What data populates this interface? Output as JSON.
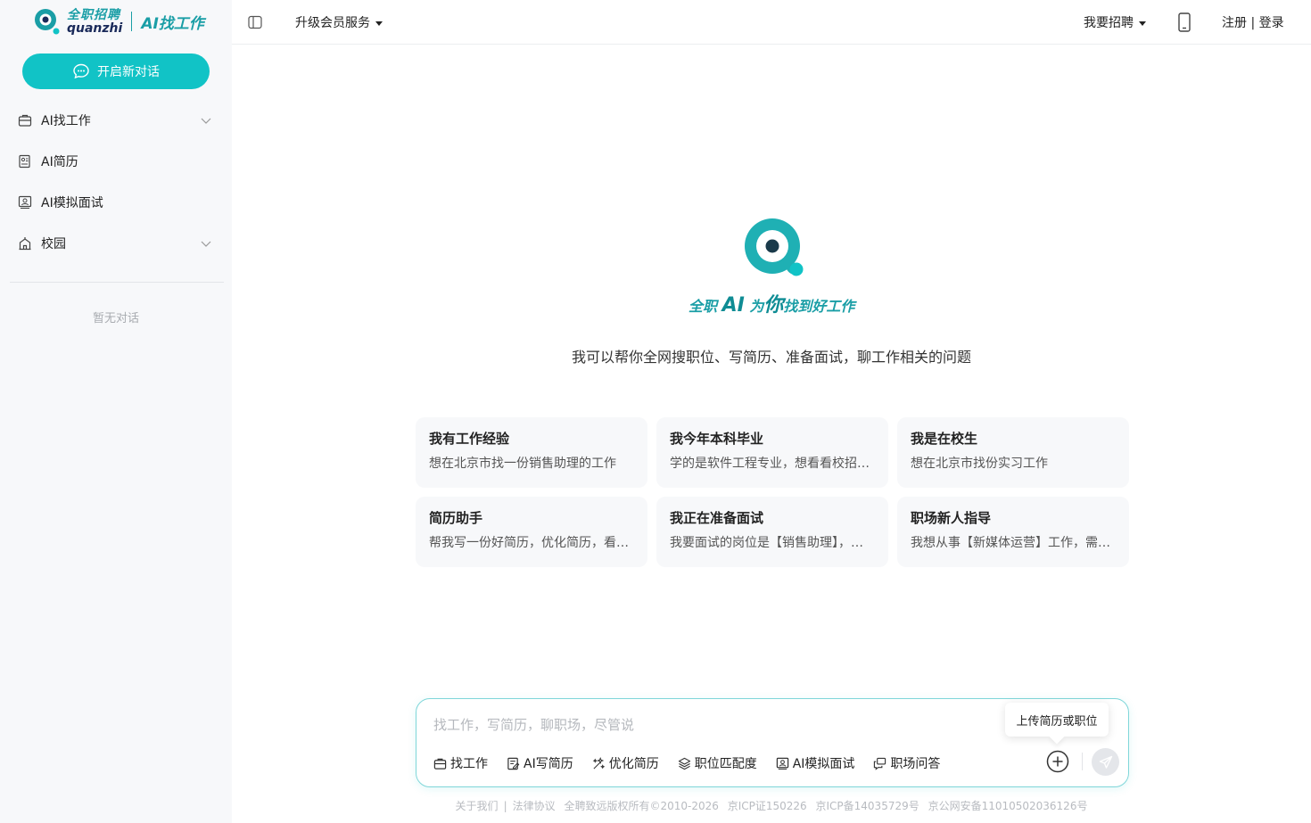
{
  "sidebar": {
    "logo": {
      "cn": "全职招聘",
      "en": "quanzhi",
      "ai": "AI找工作"
    },
    "new_chat_label": "开启新对话",
    "items": [
      {
        "label": "AI找工作",
        "icon": "briefcase-icon",
        "has_chevron": true
      },
      {
        "label": "AI简历",
        "icon": "resume-icon",
        "has_chevron": false
      },
      {
        "label": "AI模拟面试",
        "icon": "interview-icon",
        "has_chevron": false
      },
      {
        "label": "校园",
        "icon": "campus-icon",
        "has_chevron": true
      }
    ],
    "empty_text": "暂无对话"
  },
  "header": {
    "upgrade_label": "升级会员服务",
    "recruit_label": "我要招聘",
    "register_label": "注册",
    "auth_separator": "|",
    "login_label": "登录"
  },
  "hero": {
    "slogan_prefix": "全职",
    "slogan_ai": "AI",
    "slogan_for": "为",
    "slogan_you": "你",
    "slogan_rest": "找到好工作",
    "tagline": "我可以帮你全网搜职位、写简历、准备面试，聊工作相关的问题"
  },
  "cards": [
    {
      "title": "我有工作经验",
      "desc": "想在北京市找一份销售助理的工作"
    },
    {
      "title": "我今年本科毕业",
      "desc": "学的是软件工程专业，想看看校招…"
    },
    {
      "title": "我是在校生",
      "desc": "想在北京市找份实习工作"
    },
    {
      "title": "简历助手",
      "desc": "帮我写一份好简历，优化简历，看…"
    },
    {
      "title": "我正在准备面试",
      "desc": "我要面试的岗位是【销售助理】，…"
    },
    {
      "title": "职场新人指导",
      "desc": "我想从事【新媒体运营】工作，需…"
    }
  ],
  "composer": {
    "placeholder": "找工作，写简历，聊职场，尽管说",
    "tools": [
      {
        "label": "找工作",
        "icon": "briefcase-icon"
      },
      {
        "label": "AI写简历",
        "icon": "resume-write-icon"
      },
      {
        "label": "优化简历",
        "icon": "magic-wand-icon"
      },
      {
        "label": "职位匹配度",
        "icon": "layers-icon"
      },
      {
        "label": "AI模拟面试",
        "icon": "interview-icon"
      },
      {
        "label": "职场问答",
        "icon": "chat-icon"
      }
    ],
    "upload_tooltip": "上传简历或职位"
  },
  "footer": {
    "about": "关于我们",
    "sep": "|",
    "legal": "法律协议",
    "copyright": "全聘致远版权所有©2010-2026",
    "icp1": "京ICP证150226",
    "icp2": "京ICP备14035729号",
    "police": "京公网安备11010502036126号"
  },
  "colors": {
    "accent": "#11c3c6",
    "brand_dark": "#1a9ea6",
    "sidebar_bg": "#f7f8fa",
    "card_bg": "#f7f8fa"
  }
}
